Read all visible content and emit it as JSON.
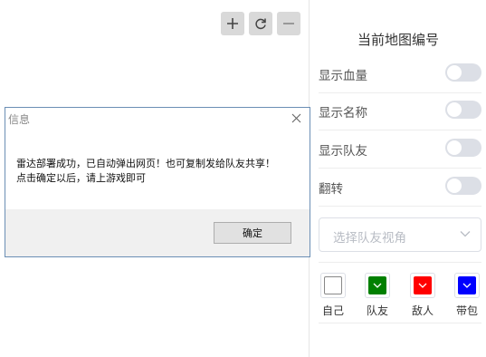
{
  "map_controls": {
    "zoom_in_icon": "plus-icon",
    "refresh_icon": "refresh-icon",
    "zoom_out_icon": "minus-icon"
  },
  "panel": {
    "title": "当前地图编号",
    "toggles": [
      {
        "label": "显示血量",
        "on": false
      },
      {
        "label": "显示名称",
        "on": false
      },
      {
        "label": "显示队友",
        "on": false
      },
      {
        "label": "翻转",
        "on": false
      }
    ],
    "teammate_view_select": {
      "placeholder": "选择队友视角"
    },
    "colors": [
      {
        "label": "自己",
        "color": "#ffffff"
      },
      {
        "label": "队友",
        "color": "#008000"
      },
      {
        "label": "敌人",
        "color": "#ff0000"
      },
      {
        "label": "带包",
        "color": "#0000ff"
      }
    ]
  },
  "dialog": {
    "title": "信息",
    "message_line1": "雷达部署成功，已自动弹出网页！也可复制发给队友共享！",
    "message_line2": "点击确定以后，请上游戏即可",
    "ok_label": "确定"
  }
}
